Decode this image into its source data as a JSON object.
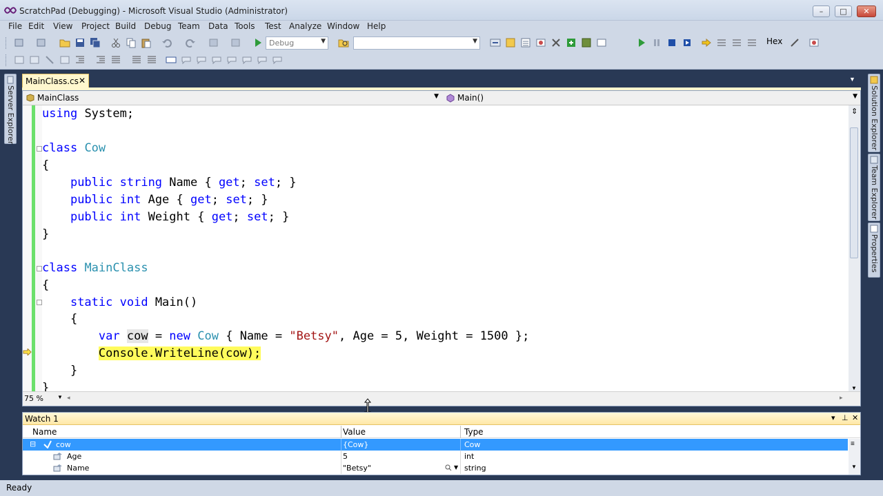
{
  "window": {
    "title": "ScratchPad (Debugging) - Microsoft Visual Studio (Administrator)",
    "minimize_glyph": "–",
    "maximize_glyph": "□",
    "close_glyph": "✕"
  },
  "menu": [
    "File",
    "Edit",
    "View",
    "Project",
    "Build",
    "Debug",
    "Team",
    "Data",
    "Tools",
    "Test",
    "Analyze",
    "Window",
    "Help"
  ],
  "toolbar": {
    "config_combo": "Debug",
    "find_combo": "",
    "hex_label": "Hex"
  },
  "side_panels": {
    "left": [
      "Server Explorer"
    ],
    "right": [
      "Solution Explorer",
      "Team Explorer",
      "Properties"
    ]
  },
  "document_tab": {
    "label": "MainClass.cs",
    "close_glyph": "✕"
  },
  "navigation": {
    "type_combo": "MainClass",
    "member_combo": "Main()"
  },
  "code_lines": [
    "using System;",
    "",
    "class Cow",
    "{",
    "    public string Name { get; set; }",
    "    public int Age { get; set; }",
    "    public int Weight { get; set; }",
    "}",
    "",
    "class MainClass",
    "{",
    "    static void Main()",
    "    {",
    "        var cow = new Cow { Name = \"Betsy\", Age = 5, Weight = 1500 };",
    "        Console.WriteLine(cow);",
    "    }",
    "}"
  ],
  "editor": {
    "zoom": "75 %",
    "current_statement": "Console.WriteLine(cow);"
  },
  "watch": {
    "title": "Watch 1",
    "columns": [
      "Name",
      "Value",
      "Type"
    ],
    "rows": [
      {
        "name": "cow",
        "value": "{Cow}",
        "type": "Cow",
        "selected": true,
        "expander": "⊟"
      },
      {
        "name": "Age",
        "value": "5",
        "type": "int",
        "selected": false
      },
      {
        "name": "Name",
        "value": "\"Betsy\"",
        "type": "string",
        "selected": false
      }
    ]
  },
  "status": {
    "text": "Ready"
  },
  "colors": {
    "keyword": "#0000ff",
    "type": "#2b91af",
    "string": "#a31515",
    "current_line_highlight": "#fffb5c",
    "selection": "#3399ff"
  }
}
